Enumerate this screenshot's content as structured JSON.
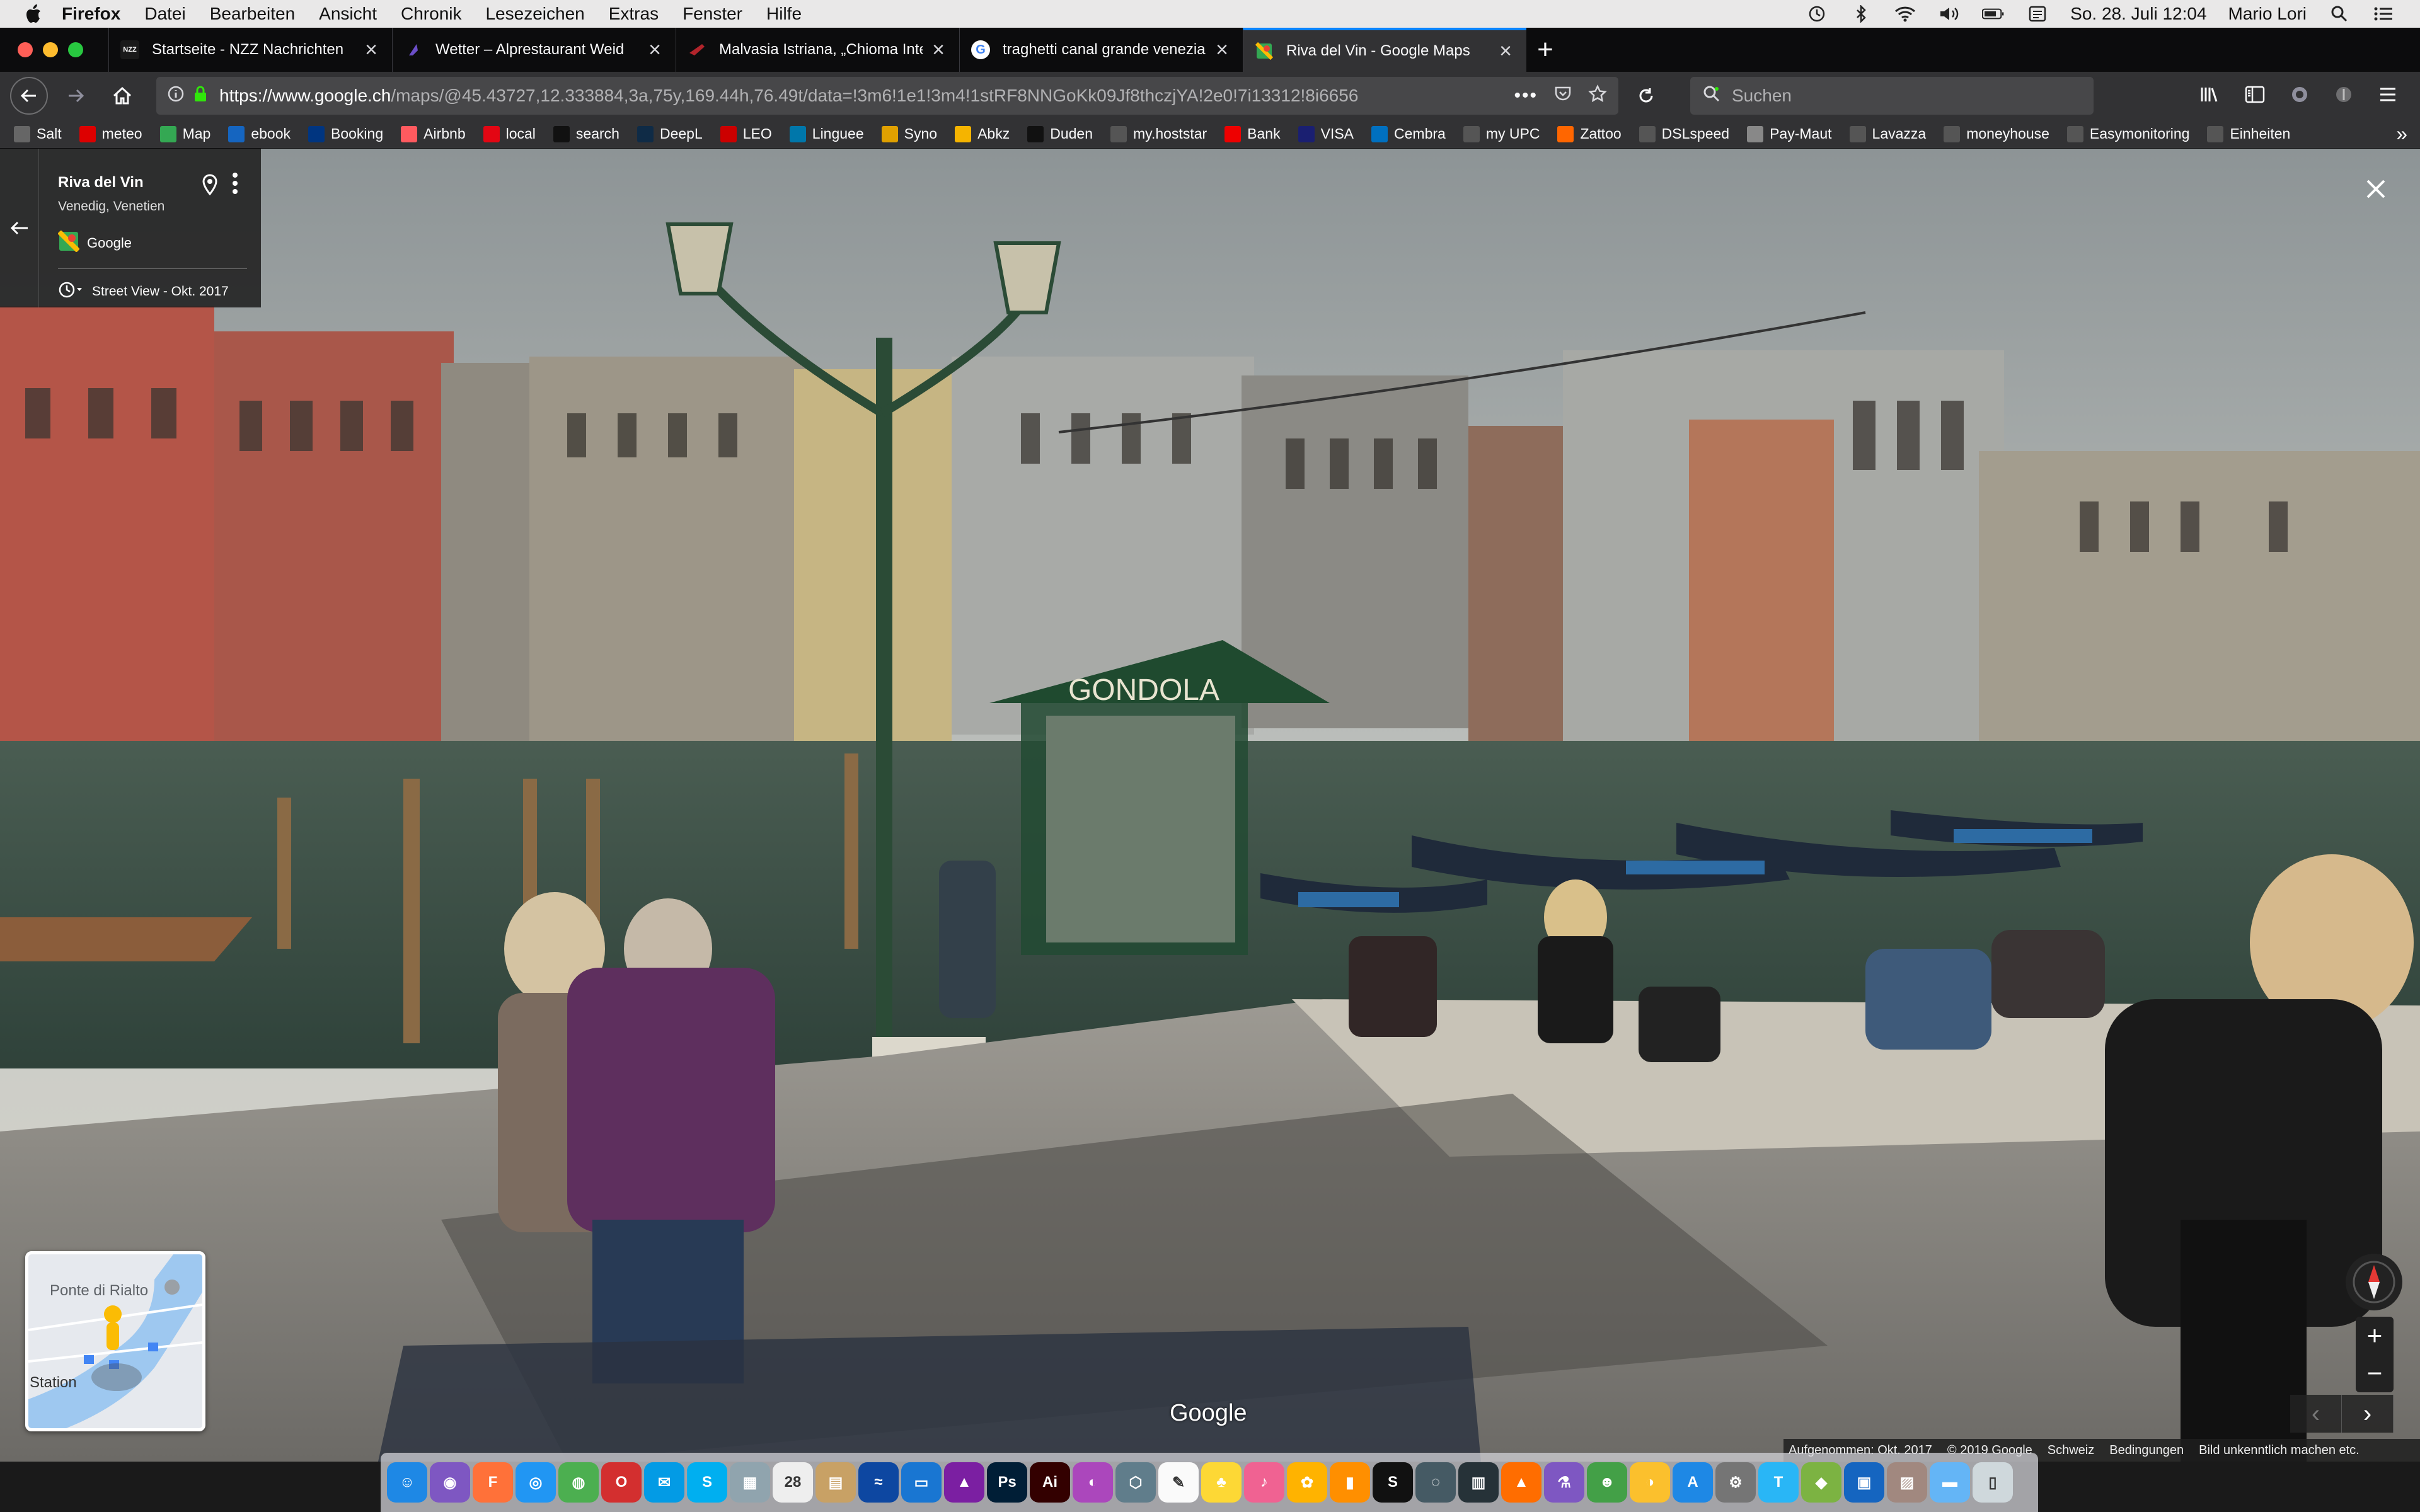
{
  "menubar": {
    "app_name": "Firefox",
    "menus": [
      "Datei",
      "Bearbeiten",
      "Ansicht",
      "Chronik",
      "Lesezeichen",
      "Extras",
      "Fenster",
      "Hilfe"
    ],
    "clock": "So. 28. Juli  12:04",
    "user": "Mario Lori"
  },
  "tabs": [
    {
      "title": "Startseite - NZZ Nachrichten",
      "favicon": "NZZ",
      "color": "#1a1a1a"
    },
    {
      "title": "Wetter – Alprestaurant Weid",
      "favicon": "W",
      "color": "#6b4ec7"
    },
    {
      "title": "Malvasia Istriana, „Chioma Integ",
      "favicon": "M",
      "color": "#b2242b"
    },
    {
      "title": "traghetti canal grande venezia",
      "favicon": "G",
      "color": "#4285f4"
    },
    {
      "title": "Riva del Vin - Google Maps",
      "favicon": "M",
      "color": "#34a853",
      "active": true
    }
  ],
  "navbar": {
    "url_host": "https://www.google.ch",
    "url_rest": "/maps/@45.43727,12.333884,3a,75y,169.44h,76.49t/data=!3m6!1e1!3m4!1stRF8NNGoKk09Jf8thczjYA!2e0!7i13312!8i6656",
    "search_placeholder": "Suchen"
  },
  "bookmarks": [
    {
      "label": "Salt",
      "color": "#666"
    },
    {
      "label": "meteo",
      "color": "#d00"
    },
    {
      "label": "Map",
      "color": "#34a853"
    },
    {
      "label": "ebook",
      "color": "#1565c0"
    },
    {
      "label": "Booking",
      "color": "#003580"
    },
    {
      "label": "Airbnb",
      "color": "#ff5a5f"
    },
    {
      "label": "local",
      "color": "#e30613"
    },
    {
      "label": "search",
      "color": "#111"
    },
    {
      "label": "DeepL",
      "color": "#0f2b46"
    },
    {
      "label": "LEO",
      "color": "#c00"
    },
    {
      "label": "Linguee",
      "color": "#0077aa"
    },
    {
      "label": "Syno",
      "color": "#e0a000"
    },
    {
      "label": "Abkz",
      "color": "#f5b400"
    },
    {
      "label": "Duden",
      "color": "#111"
    },
    {
      "label": "my.hoststar",
      "color": "#555"
    },
    {
      "label": "Bank",
      "color": "#e00"
    },
    {
      "label": "VISA",
      "color": "#1a1f71"
    },
    {
      "label": "Cembra",
      "color": "#0070c0"
    },
    {
      "label": "my UPC",
      "color": "#555"
    },
    {
      "label": "Zattoo",
      "color": "#f60"
    },
    {
      "label": "DSLspeed",
      "color": "#555"
    },
    {
      "label": "Pay-Maut",
      "color": "#888"
    },
    {
      "label": "Lavazza",
      "color": "#555"
    },
    {
      "label": "moneyhouse",
      "color": "#555"
    },
    {
      "label": "Easymonitoring",
      "color": "#555"
    },
    {
      "label": "Einheiten",
      "color": "#555"
    }
  ],
  "streetview": {
    "place_title": "Riva del Vin",
    "place_subtitle": "Venedig, Venetien",
    "provider": "Google",
    "date_label": "Street View - Okt. 2017",
    "sign_text": "GONDOLA",
    "watermark": "Google",
    "minimap_label_top": "Ponte di Rialto",
    "minimap_label_bottom": "Station",
    "footer": {
      "captured": "Aufgenommen: Okt. 2017",
      "copyright": "© 2019 Google",
      "region": "Schweiz",
      "terms": "Bedingungen",
      "report": "Bild unkenntlich machen etc."
    }
  },
  "dock_icons": [
    {
      "name": "finder",
      "color": "#1e88e5",
      "glyph": "☺"
    },
    {
      "name": "siri",
      "color": "#7e57c2",
      "glyph": "◉"
    },
    {
      "name": "firefox",
      "color": "#ff7139",
      "glyph": "F"
    },
    {
      "name": "safari",
      "color": "#2196f3",
      "glyph": "◎"
    },
    {
      "name": "chrome",
      "color": "#4caf50",
      "glyph": "◍"
    },
    {
      "name": "opera",
      "color": "#d32f2f",
      "glyph": "O"
    },
    {
      "name": "app",
      "color": "#039be5",
      "glyph": "✉"
    },
    {
      "name": "skype",
      "color": "#00aff0",
      "glyph": "S"
    },
    {
      "name": "preview",
      "color": "#90a4ae",
      "glyph": "▦"
    },
    {
      "name": "calendar",
      "color": "#eeeeee",
      "glyph": "28"
    },
    {
      "name": "notes",
      "color": "#c8a165",
      "glyph": "▤"
    },
    {
      "name": "app",
      "color": "#0d47a1",
      "glyph": "≈"
    },
    {
      "name": "keynote",
      "color": "#1976d2",
      "glyph": "▭"
    },
    {
      "name": "affinity",
      "color": "#7b1fa2",
      "glyph": "▲"
    },
    {
      "name": "photoshop",
      "color": "#001e36",
      "glyph": "Ps"
    },
    {
      "name": "illustrator",
      "color": "#330000",
      "glyph": "Ai"
    },
    {
      "name": "app",
      "color": "#ab47bc",
      "glyph": "◐"
    },
    {
      "name": "app",
      "color": "#607d8b",
      "glyph": "⬡"
    },
    {
      "name": "textedit",
      "color": "#fafafa",
      "glyph": "✎"
    },
    {
      "name": "cyberduck",
      "color": "#fdd835",
      "glyph": "♣"
    },
    {
      "name": "music",
      "color": "#f06292",
      "glyph": "♪"
    },
    {
      "name": "photos",
      "color": "#ffb300",
      "glyph": "✿"
    },
    {
      "name": "books",
      "color": "#ff8f00",
      "glyph": "▮"
    },
    {
      "name": "sonos",
      "color": "#111111",
      "glyph": "S"
    },
    {
      "name": "app",
      "color": "#455a64",
      "glyph": "◌"
    },
    {
      "name": "app",
      "color": "#263238",
      "glyph": "▥"
    },
    {
      "name": "vlc",
      "color": "#ff6d00",
      "glyph": "▲"
    },
    {
      "name": "app",
      "color": "#7e57c2",
      "glyph": "⚗"
    },
    {
      "name": "app",
      "color": "#43a047",
      "glyph": "☻"
    },
    {
      "name": "app",
      "color": "#fbc02d",
      "glyph": "◑"
    },
    {
      "name": "appstore",
      "color": "#1e88e5",
      "glyph": "A"
    },
    {
      "name": "settings",
      "color": "#757575",
      "glyph": "⚙"
    },
    {
      "name": "app",
      "color": "#29b6f6",
      "glyph": "T"
    },
    {
      "name": "app",
      "color": "#7cb342",
      "glyph": "◆"
    },
    {
      "name": "app",
      "color": "#1565c0",
      "glyph": "▣"
    },
    {
      "name": "app",
      "color": "#a1887f",
      "glyph": "▨"
    },
    {
      "name": "downloads",
      "color": "#64b5f6",
      "glyph": "▬"
    },
    {
      "name": "trash",
      "color": "#cfd8dc",
      "glyph": "▯"
    }
  ]
}
